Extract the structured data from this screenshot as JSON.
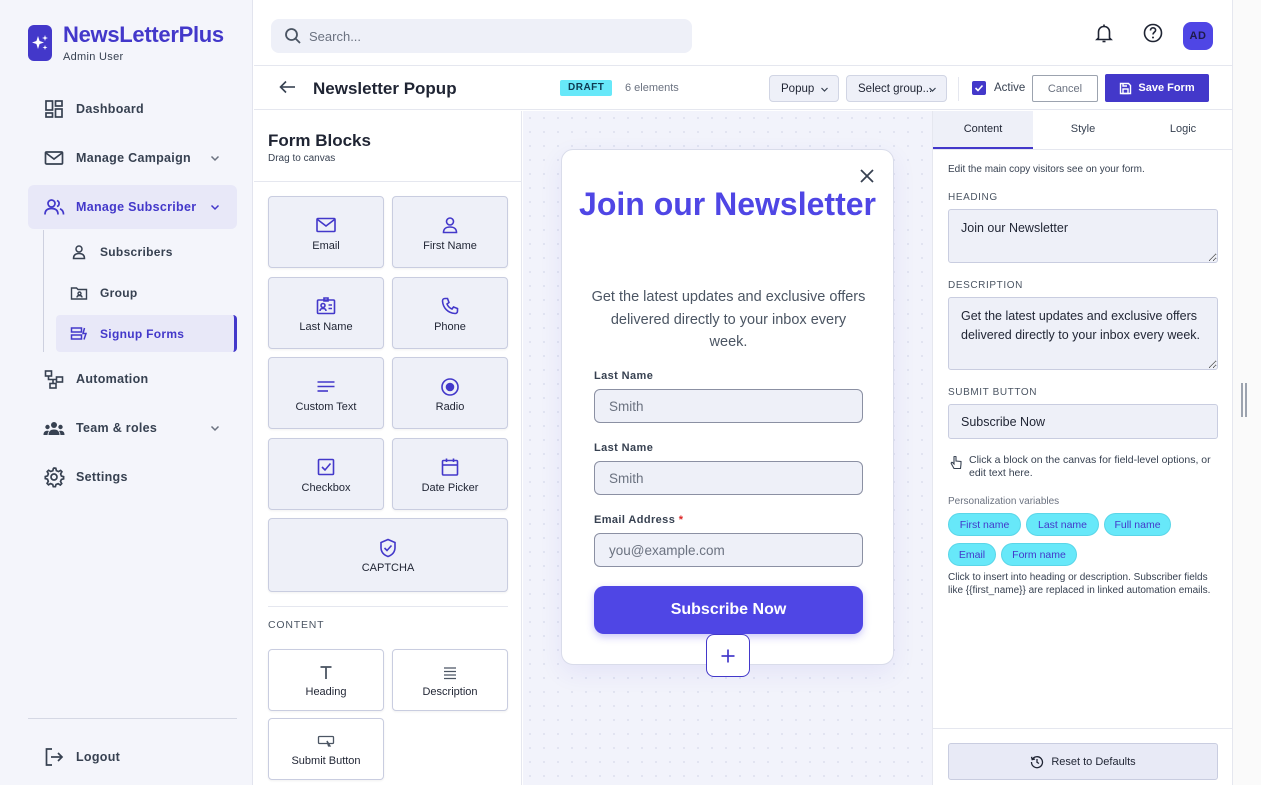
{
  "app": {
    "name": "NewsLetterPlus",
    "user": "Admin User"
  },
  "sidebar": {
    "items": [
      {
        "label": "Dashboard"
      },
      {
        "label": "Manage Campaign"
      },
      {
        "label": "Manage Subscriber"
      },
      {
        "label": "Automation"
      },
      {
        "label": "Team & roles"
      },
      {
        "label": "Settings"
      }
    ],
    "sub_items": [
      {
        "label": "Subscribers"
      },
      {
        "label": "Group"
      },
      {
        "label": "Signup Forms"
      }
    ],
    "logout": "Logout"
  },
  "topbar": {
    "search_placeholder": "Search...",
    "avatar_initials": "AD"
  },
  "header": {
    "title": "Newsletter Popup",
    "status": "DRAFT",
    "element_count": "6 elements",
    "type_select": "Popup",
    "group_select": "Select group...",
    "active_label": "Active",
    "active_checked": true,
    "cancel_label": "Cancel",
    "save_label": "Save Form"
  },
  "blocks": {
    "title": "Form Blocks",
    "subtitle": "Drag to canvas",
    "fields": [
      {
        "label": "Email",
        "icon": "envelope-icon"
      },
      {
        "label": "First Name",
        "icon": "user-icon"
      },
      {
        "label": "Last Name",
        "icon": "id-card-icon"
      },
      {
        "label": "Phone",
        "icon": "phone-icon"
      },
      {
        "label": "Custom Text",
        "icon": "text-lines-icon"
      },
      {
        "label": "Radio",
        "icon": "radio-icon"
      },
      {
        "label": "Checkbox",
        "icon": "checkbox-icon"
      },
      {
        "label": "Date Picker",
        "icon": "calendar-icon"
      },
      {
        "label": "CAPTCHA",
        "icon": "shield-check-icon"
      }
    ],
    "content_heading": "CONTENT",
    "content": [
      {
        "label": "Heading",
        "icon": "heading-icon"
      },
      {
        "label": "Description",
        "icon": "paragraph-icon"
      },
      {
        "label": "Submit Button",
        "icon": "button-icon"
      }
    ]
  },
  "preview": {
    "heading": "Join our Newsletter",
    "description": "Get the latest updates and exclusive offers delivered directly to your inbox every week.",
    "fields": [
      {
        "label": "Last Name",
        "placeholder": "Smith",
        "required": false
      },
      {
        "label": "Last Name",
        "placeholder": "Smith",
        "required": false
      },
      {
        "label": "Email Address",
        "placeholder": "you@example.com",
        "required": true
      }
    ],
    "required_mark": "*",
    "submit_label": "Subscribe Now"
  },
  "properties": {
    "tabs": [
      "Content",
      "Style",
      "Logic"
    ],
    "active_tab": "Content",
    "help": "Edit the main copy visitors see on your form.",
    "heading_label": "HEADING",
    "heading_value": "Join our Newsletter",
    "description_label": "DESCRIPTION",
    "description_value": "Get the latest updates and exclusive offers delivered directly to your inbox every week.",
    "submit_label": "SUBMIT BUTTON",
    "submit_value": "Subscribe Now",
    "hint": "Click a block on the canvas for field-level options, or edit text here.",
    "variables_label": "Personalization variables",
    "variables": [
      "First name",
      "Last name",
      "Full name",
      "Email",
      "Form name"
    ],
    "note": "Click to insert into heading or description. Subscriber fields like {{first_name}} are replaced in linked automation emails.",
    "reset_label": "Reset to Defaults"
  },
  "colors": {
    "accent": "#4338ca",
    "heading": "#4f46e5",
    "chip": "#67e8f9"
  }
}
